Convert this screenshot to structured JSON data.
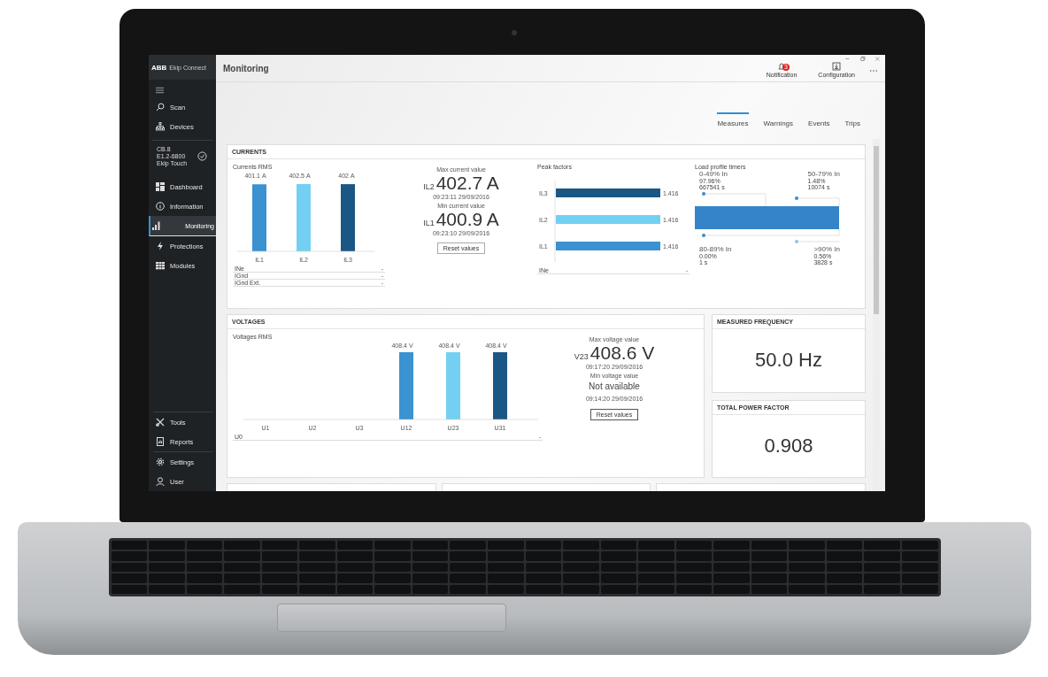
{
  "sidebar": {
    "logo": "ABB",
    "app_name": "Ekip Connect",
    "top_items": [
      {
        "label": "Scan"
      },
      {
        "label": "Devices"
      }
    ],
    "device": {
      "lines": [
        "CB.8",
        "E1.2-6800",
        "Ekip Touch"
      ],
      "connected": true
    },
    "items": [
      {
        "label": "Dashboard",
        "selected": false
      },
      {
        "label": "Information",
        "selected": false
      },
      {
        "label": "Monitoring",
        "selected": true
      },
      {
        "label": "Protections",
        "selected": false
      },
      {
        "label": "Modules",
        "selected": false
      }
    ],
    "bottom_items": [
      {
        "label": "Tools"
      },
      {
        "label": "Reports"
      },
      {
        "label": "Settings"
      },
      {
        "label": "User"
      }
    ]
  },
  "header": {
    "title": "Monitoring",
    "actions": [
      {
        "label": "Notification",
        "badge": "3"
      },
      {
        "label": "Configuration"
      }
    ]
  },
  "tabs": [
    {
      "label": "Measures",
      "selected": true
    },
    {
      "label": "Warnings",
      "selected": false
    },
    {
      "label": "Events",
      "selected": false
    },
    {
      "label": "Trips",
      "selected": false
    }
  ],
  "currents": {
    "title": "CURRENTS",
    "chart_data": {
      "type": "bar",
      "title": "Currents RMS",
      "categories": [
        "IL1",
        "IL2",
        "IL3"
      ],
      "series": [
        {
          "values": [
            401.1,
            402.5,
            402
          ]
        }
      ],
      "data_labels": true,
      "ylabel": "A"
    },
    "selectors": [
      {
        "label": "INe",
        "value": "-"
      },
      {
        "label": "IGnd",
        "value": "-"
      },
      {
        "label": "IGnd Ext.",
        "value": "-"
      }
    ],
    "max": {
      "caption": "Max current value",
      "phase": "IL2",
      "value": "402.7 A",
      "time": "09:23:11 29/09/2016"
    },
    "min": {
      "caption": "Min current value",
      "phase": "IL1",
      "value": "400.9 A",
      "time": "09:23:10 29/09/2016"
    },
    "reset": "Reset values",
    "peak_factors": {
      "chart_data": {
        "type": "bar",
        "title": "Peak factors",
        "orientation": "horizontal",
        "categories": [
          "IL3",
          "IL2",
          "IL1"
        ],
        "series": [
          {
            "values": [
              1.416,
              1.416,
              1.416
            ]
          }
        ],
        "data_labels": true
      },
      "selector": {
        "label": "INe",
        "value": "-"
      }
    },
    "load_label": "Load profile timers",
    "load_ranges": [
      {
        "range": "0-49% In",
        "percent": "97.96%",
        "seconds": "667541 s"
      },
      {
        "range": "50-79% In",
        "percent": "1.48%",
        "seconds": "10074 s"
      },
      {
        "range": "80-89% In",
        "percent": "0.00%",
        "seconds": "1 s"
      },
      {
        "range": ">90% In",
        "percent": "0.56%",
        "seconds": "3828 s"
      }
    ]
  },
  "voltages": {
    "title": "VOLTAGES",
    "chart_data": {
      "type": "bar",
      "title": "Voltages RMS",
      "categories": [
        "U1",
        "U2",
        "U3",
        "U12",
        "U23",
        "U31"
      ],
      "series": [
        {
          "values": [
            null,
            null,
            null,
            408.4,
            408.4,
            408.4
          ]
        }
      ],
      "data_labels": true,
      "ylabel": "V"
    },
    "selectors": [
      {
        "label": "U0",
        "value": "-"
      }
    ],
    "max": {
      "caption": "Max voltage value",
      "phase": "V23",
      "value": "408.6 V",
      "time": "09:17:20 29/09/2016"
    },
    "min": {
      "caption": "Min voltage value",
      "value": "Not available",
      "time": "09:14:20 29/09/2016"
    },
    "reset": "Reset values"
  },
  "frequency": {
    "title": "MEASURED FREQUENCY",
    "value": "50.0 Hz"
  },
  "power_factor": {
    "title": "TOTAL POWER FACTOR",
    "value": "0.908"
  }
}
